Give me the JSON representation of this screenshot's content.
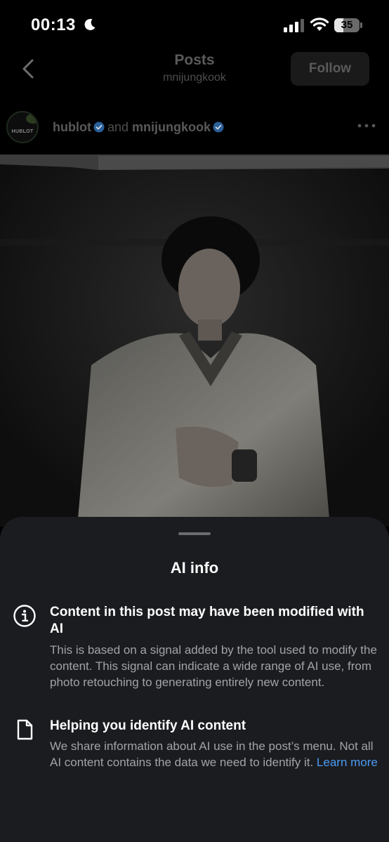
{
  "status_bar": {
    "time": "00:13",
    "battery": "35",
    "battery_level_percent": 35
  },
  "nav": {
    "title": "Posts",
    "subtitle": "mnijungkook",
    "follow_label": "Follow"
  },
  "post": {
    "avatar_text": "HUBLOT",
    "author_1": "hublot",
    "joiner": "and",
    "author_2": "mnijungkook"
  },
  "sheet": {
    "title": "AI info",
    "item_1": {
      "heading": "Content in this post may have been modified with AI",
      "body": "This is based on a signal added by the tool used to modify the content. This signal can indicate a wide range of AI use, from photo retouching to generating entirely new content.",
      "icon": "info-circle-icon"
    },
    "item_2": {
      "heading": "Helping you identify AI content",
      "body": "We share information about AI use in the post’s menu. Not all AI content contains the data we need to identify it.",
      "link": "Learn more",
      "icon": "document-icon"
    }
  },
  "colors": {
    "sheet_bg": "#1b1c1f",
    "link": "#4a9bf5",
    "verified": "#2a7ee8"
  }
}
